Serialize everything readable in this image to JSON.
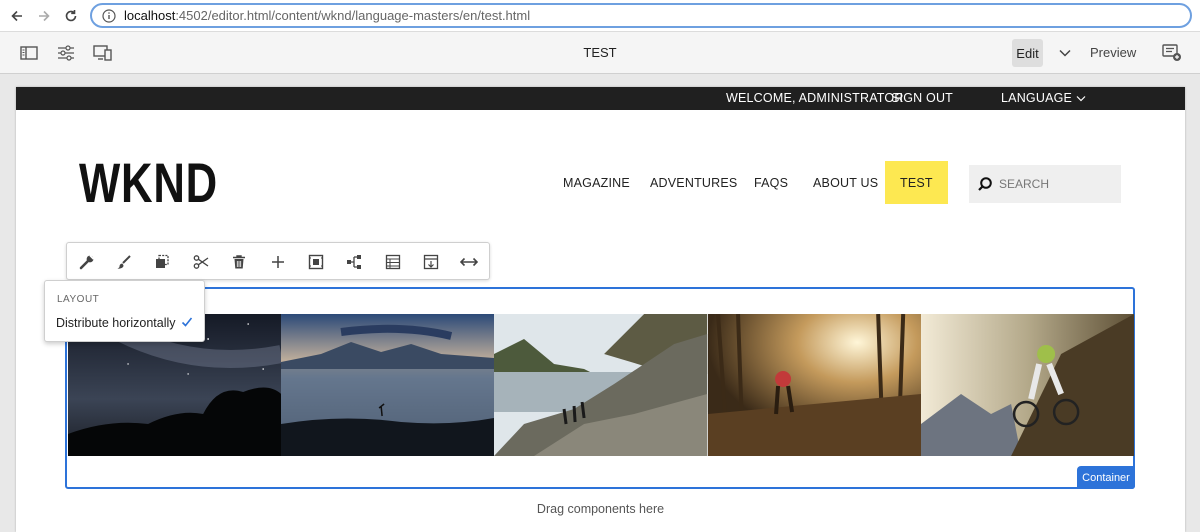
{
  "browser": {
    "url_host": "localhost",
    "url_path": ":4502/editor.html/content/wknd/language-masters/en/test.html"
  },
  "editor": {
    "page_title": "TEST",
    "edit_label": "Edit",
    "preview_label": "Preview"
  },
  "site": {
    "topbar": {
      "welcome": "WELCOME, ADMINISTRATOR",
      "sign_out": "SIGN OUT",
      "language": "LANGUAGE"
    },
    "logo": "WKND",
    "nav": {
      "items": [
        "MAGAZINE",
        "ADVENTURES",
        "FAQS",
        "ABOUT US",
        "TEST"
      ],
      "active": "TEST"
    },
    "search_placeholder": "SEARCH"
  },
  "component_toolbar": {
    "icons": [
      "wrench-icon",
      "brush-icon",
      "copy-icon",
      "cut-icon",
      "delete-icon",
      "add-icon",
      "group-icon",
      "parent-icon",
      "layout-icon",
      "insert-icon",
      "distribute-icon"
    ]
  },
  "layout_popover": {
    "heading": "LAYOUT",
    "item": "Distribute horizontally",
    "checked": true
  },
  "container": {
    "badge": "Container",
    "images": [
      "night-sky-image",
      "lake-mountains-image",
      "hikers-rocks-image",
      "forest-hiker-image",
      "mountain-biker-image"
    ]
  },
  "drag_hint": "Drag components here",
  "colors": {
    "accent_blue": "#2d73d9",
    "nav_highlight": "#fde851",
    "topbar": "#202020"
  }
}
